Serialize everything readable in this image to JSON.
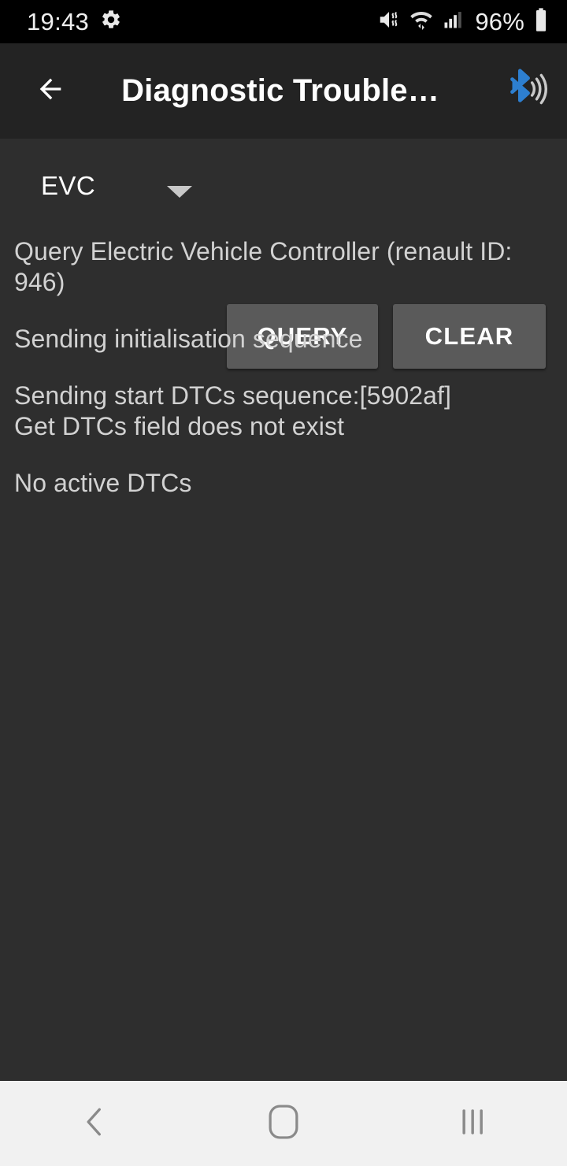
{
  "status_bar": {
    "time": "19:43",
    "gear_icon": "settings-gear-icon",
    "mute_icon": "volume-mute-icon",
    "wifi_icon": "wifi-data-transfer-icon",
    "signal_icon": "cellular-signal-icon",
    "battery_percent": "96%",
    "battery_icon": "battery-full-icon",
    "background": "#000000"
  },
  "app_bar": {
    "back_icon": "arrow-back-icon",
    "title": "Diagnostic Trouble…",
    "bluetooth_icon": "bluetooth-connected-icon",
    "bluetooth_color": "#2d7fd0",
    "background": "#232323"
  },
  "controls": {
    "ecu_spinner": {
      "selected": "EVC",
      "caret_icon": "chevron-down-icon"
    },
    "query_label": "QUERY",
    "clear_label": "CLEAR",
    "button_color": "#5a5a5a"
  },
  "log": {
    "entries": [
      "Query Electric Vehicle Controller (renault ID: 946)",
      "Sending initialisation sequence",
      "Sending start DTCs sequence:[5902af]\nGet DTCs field does not exist",
      "No active DTCs"
    ],
    "text_color": "#d2d2d2",
    "background": "#2e2e2e"
  },
  "navigation_bar": {
    "back_icon": "nav-back-chevron-icon",
    "home_icon": "nav-home-icon",
    "recents_icon": "nav-recents-icon",
    "background": "#f1f1f1",
    "icon_color": "#8a8a8a"
  }
}
